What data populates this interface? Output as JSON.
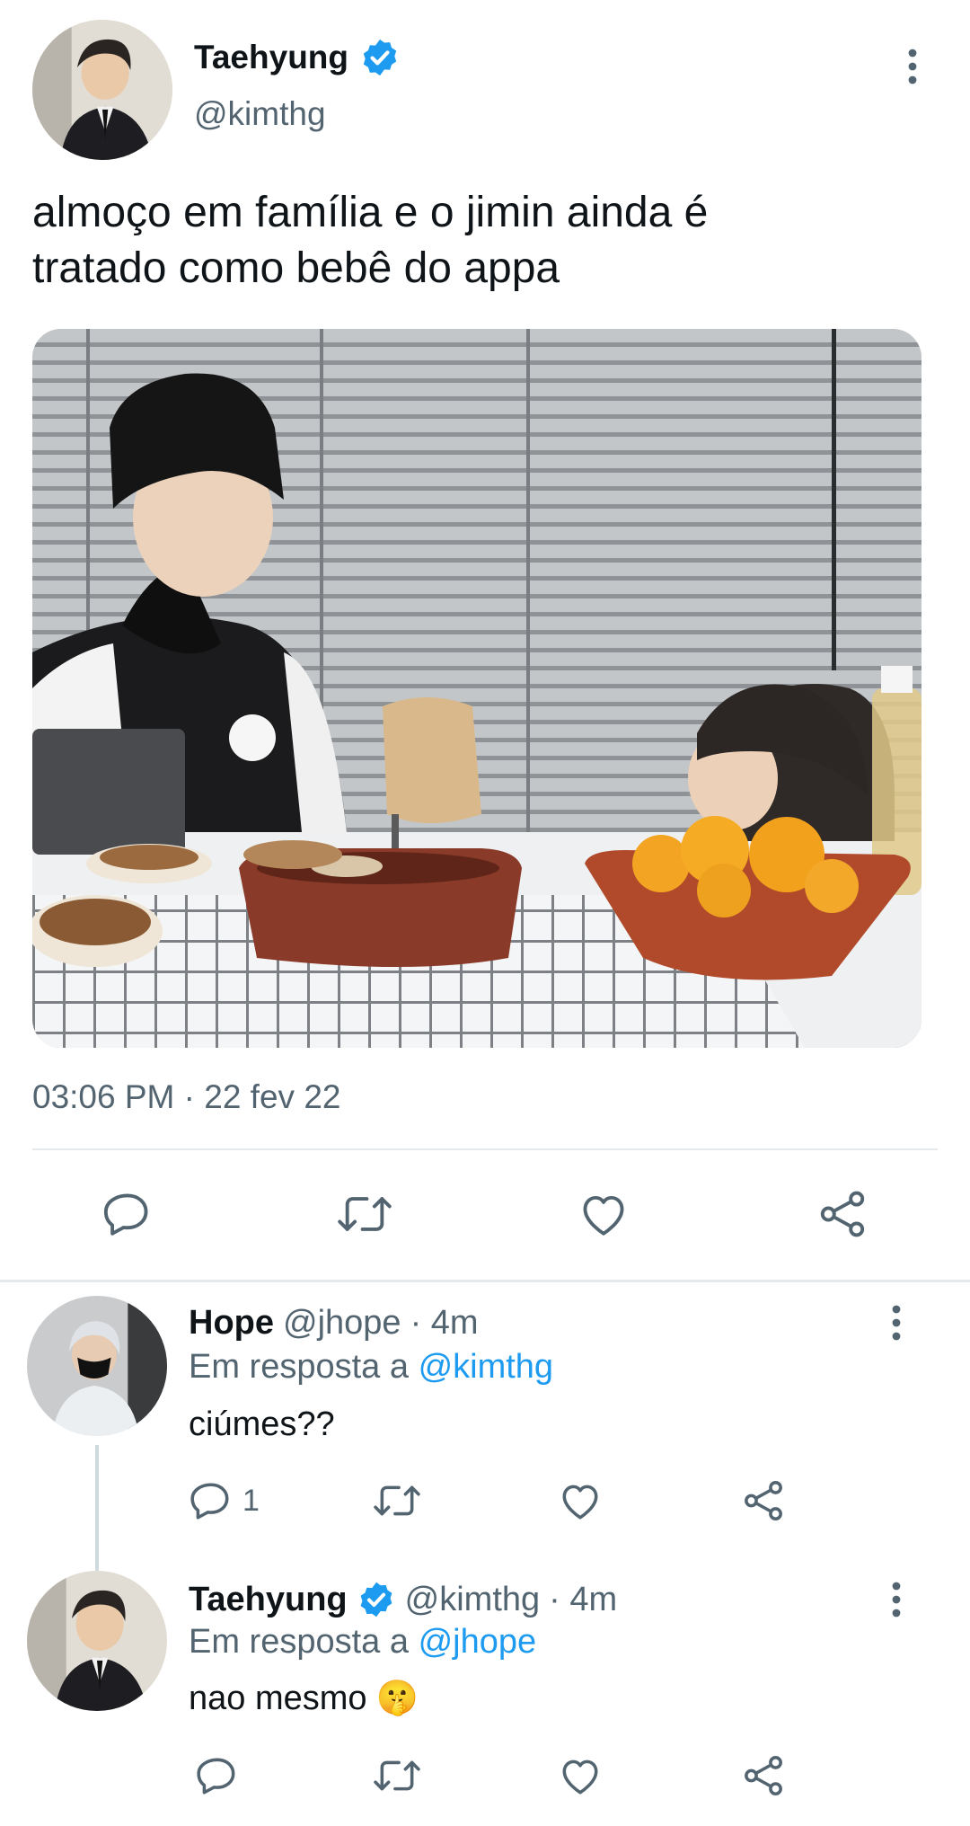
{
  "tweet": {
    "author_name": "Taehyung",
    "author_handle": "@kimthg",
    "verified": true,
    "text_line1": "almoço em família e o jimin ainda é",
    "text_line2": "tratado como bebê do appa",
    "timestamp": "03:06 PM · 22 fev 22",
    "actions": [
      "reply-icon",
      "retweet-icon",
      "like-icon",
      "share-icon"
    ]
  },
  "replies": [
    {
      "author_name": "Hope",
      "author_handle": "@jhope",
      "time": "· 4m",
      "reply_to_prefix": "Em resposta a",
      "reply_to_handle": "@kimthg",
      "text": "ciúmes??",
      "reply_count": "1"
    },
    {
      "author_name": "Taehyung",
      "verified": true,
      "author_handle": "@kimthg",
      "time": "· 4m",
      "reply_to_prefix": "Em resposta a",
      "reply_to_handle": "@jhope",
      "text": "nao mesmo",
      "emoji": "🤫"
    }
  ],
  "colors": {
    "accent": "#1d9bf0",
    "text_primary": "#0f1419",
    "text_muted": "#536471",
    "divider": "#e6e9ec"
  }
}
